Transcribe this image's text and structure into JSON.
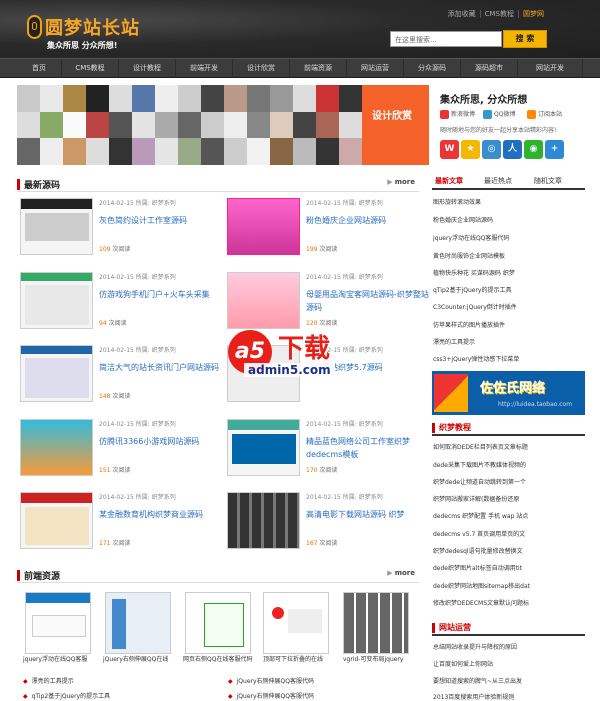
{
  "header": {
    "logo_text": "圆梦站长站",
    "slogan": "集众所思 分众所想!",
    "links": [
      "添加收藏",
      "CMS教程",
      "圆梦网"
    ],
    "search": {
      "placeholder": "在这里搜索...",
      "button": "搜 索"
    }
  },
  "nav": [
    "首页",
    "CMS教程",
    "设计教程",
    "前端开发",
    "设计欣赏",
    "前端资源",
    "网站运营",
    "分众源码",
    "源码超市",
    "网站开发"
  ],
  "banner": {
    "design_label": "设计欣赏",
    "motto": "集众所思, 分众所想",
    "subscribe": [
      "新浪微博",
      "QQ微博",
      "订阅本站"
    ],
    "tip": "随时随地与您的好友一起分享本站精彩内容!",
    "share_icons": [
      "weibo",
      "qzone",
      "tencent-weibo",
      "renren",
      "wechat",
      "more"
    ]
  },
  "latest_source": {
    "title": "最新源码",
    "more": "more",
    "items": [
      {
        "date": "2014-02-15",
        "cat_label": "所属:",
        "cat": "织梦系列",
        "title": "灰色简约设计工作室源码",
        "reads": "109",
        "reads_label": "次阅读"
      },
      {
        "date": "2014-02-15",
        "cat_label": "所属:",
        "cat": "织梦系列",
        "title": "粉色婚庆企业网站源码",
        "reads": "199",
        "reads_label": "次阅读"
      },
      {
        "date": "2014-02-15",
        "cat_label": "所属:",
        "cat": "织梦系列",
        "title": "仿游戏狗手机门户+火车头采集",
        "reads": "94",
        "reads_label": "次阅读"
      },
      {
        "date": "2014-02-15",
        "cat_label": "所属:",
        "cat": "织梦系列",
        "title": "母婴用品淘宝客网站源码-织梦整站源码",
        "reads": "120",
        "reads_label": "次阅读"
      },
      {
        "date": "2014-02-15",
        "cat_label": "所属:",
        "cat": "织梦系列",
        "title": "简洁大气的站长资讯门户网站源码",
        "reads": "148",
        "reads_label": "次阅读"
      },
      {
        "date": "2014-02-15",
        "cat_label": "所属:",
        "cat": "织梦系列",
        "title": "门户网站织梦5.7源码",
        "reads": "",
        "reads_label": ""
      },
      {
        "date": "2014-02-15",
        "cat_label": "所属:",
        "cat": "织梦系列",
        "title": "仿腾讯3366小游戏网站源码",
        "reads": "151",
        "reads_label": "次阅读"
      },
      {
        "date": "2014-02-15",
        "cat_label": "所属:",
        "cat": "织梦系列",
        "title": "精品蓝色网络公司工作室织梦dedecms模板",
        "reads": "170",
        "reads_label": "次阅读"
      },
      {
        "date": "2014-02-15",
        "cat_label": "所属:",
        "cat": "织梦系列",
        "title": "某金融数育机构织梦商业源码",
        "reads": "171",
        "reads_label": "次阅读"
      },
      {
        "date": "2014-02-15",
        "cat_label": "所属:",
        "cat": "织梦系列",
        "title": "高清电影下载网站源码 织梦",
        "reads": "167",
        "reads_label": "次阅读"
      }
    ]
  },
  "right": {
    "tabs": [
      "最新文章",
      "最近热点",
      "随机文章"
    ],
    "latest": [
      "图形旋转滚动效果",
      "粉色婚庆企业网站源码",
      "jquery浮动在线QQ客服代码",
      "黄色时尚服饰企业网站模板",
      "植物快乐种花 买谋码源码 织梦",
      "qTip2基于jQuery的提示工具",
      "C3Counter:jQuery倒计时插件",
      "仿苹果样式的图片播放插件",
      "漂亮的工具提示",
      "css3+jQuery弹性动感下拉菜单"
    ],
    "ad": {
      "text": "佐佐氏网络",
      "url": "http://luidea.taobao.com"
    },
    "dede_title": "织梦教程",
    "dede": [
      "如何取消DEDE栏目列表页文章标题",
      "dede采集下载图片不教媒体视频的",
      "织梦dede让频道自动跳转到第一个",
      "织梦网站搬家详解(数据备份还原",
      "dedecms 织梦配置 手机 wap 站点",
      "dedecms v5.7 首页调用单页的文",
      "织梦dedesql语句批量修改替换文",
      "dede织梦图片alt标签自动调用tit",
      "dede织梦网站地图sitemap移出dat",
      "修改织梦DEDECMS文章默认问题标"
    ],
    "ops_title": "网站运营",
    "ops": [
      "总结网站收录提升与降权的原因",
      "让百度如何爱上你网站",
      "要想知道搜索的脾气~从三点出发",
      "2013百度搜索用户体验新规则"
    ]
  },
  "frontend": {
    "title": "前端资源",
    "more": "more",
    "items": [
      "jquery浮动在线QQ客服",
      "jQuery右侧伸展QQ在线",
      "网页右侧QQ在线客服代码",
      "顶部可下拉折叠的在线",
      "vgrid-可变布局jquery"
    ],
    "list": [
      "漂亮的工具提示",
      "jQuery右侧伸展QQ客服代码",
      "qTip2基于jQuery的提示工具",
      "jQuery右侧伸展QQ客服代码"
    ]
  },
  "watermark": {
    "logo": "a5",
    "text": "下载",
    "url": "admin5.com"
  }
}
